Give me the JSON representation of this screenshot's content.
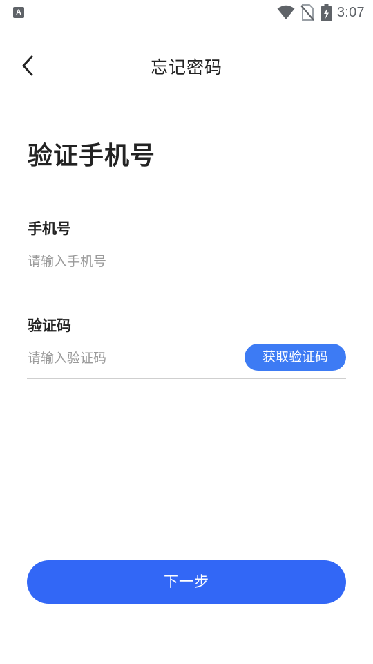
{
  "status_bar": {
    "app_icon_letter": "A",
    "time": "3:07",
    "icons": [
      "wifi-icon",
      "no-sim-icon",
      "battery-charging-icon"
    ]
  },
  "nav": {
    "back_icon": "chevron-left-icon",
    "title": "忘记密码"
  },
  "main": {
    "heading": "验证手机号",
    "phone": {
      "label": "手机号",
      "placeholder": "请输入手机号",
      "value": ""
    },
    "code": {
      "label": "验证码",
      "placeholder": "请输入验证码",
      "value": "",
      "get_code_label": "获取验证码"
    },
    "next_label": "下一步"
  },
  "colors": {
    "primary": "#3267f6",
    "code_button": "#3d7bf4",
    "divider": "#cfcfcf",
    "placeholder": "#9a9a9a",
    "text": "#222222"
  }
}
